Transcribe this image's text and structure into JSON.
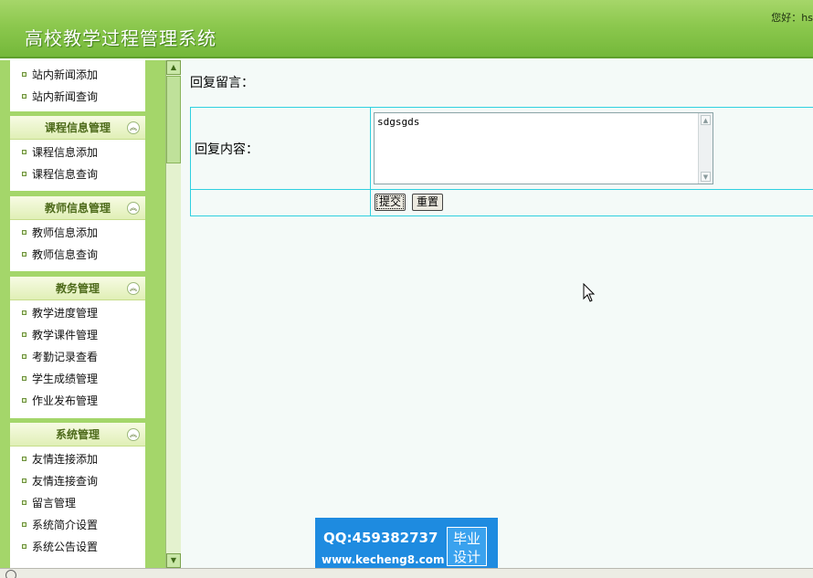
{
  "header": {
    "title": "高校教学过程管理系统",
    "greeting": "您好：hs"
  },
  "sidebar": {
    "group0_items": [
      "站内新闻添加",
      "站内新闻查询"
    ],
    "groups": [
      {
        "title": "课程信息管理",
        "items": [
          "课程信息添加",
          "课程信息查询"
        ]
      },
      {
        "title": "教师信息管理",
        "items": [
          "教师信息添加",
          "教师信息查询"
        ]
      },
      {
        "title": "教务管理",
        "items": [
          "教学进度管理",
          "教学课件管理",
          "考勤记录查看",
          "学生成绩管理",
          "作业发布管理"
        ]
      },
      {
        "title": "系统管理",
        "items": [
          "友情连接添加",
          "友情连接查询",
          "留言管理",
          "系统简介设置",
          "系统公告设置"
        ]
      }
    ]
  },
  "main": {
    "heading": "回复留言：",
    "reply_label": "回复内容：",
    "reply_value": "sdgsgds",
    "submit_label": "提交",
    "reset_label": "重置"
  },
  "watermark": {
    "qq": "QQ:459382737",
    "url": "www.kecheng8.com",
    "badge_line1": "毕业",
    "badge_line2": "设计"
  }
}
